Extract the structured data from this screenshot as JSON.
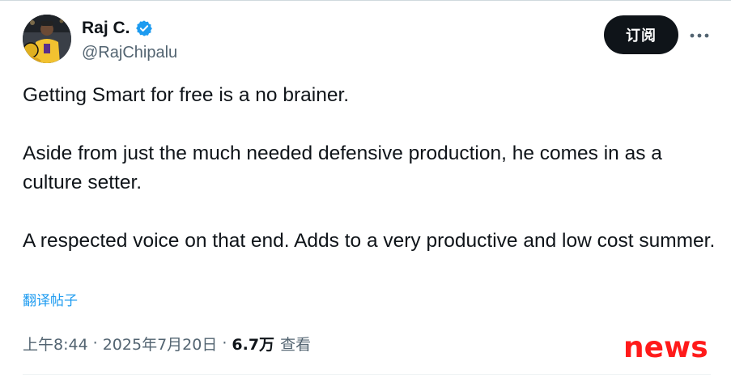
{
  "author": {
    "display_name": "Raj C.",
    "handle": "@RajChipalu",
    "verified": true,
    "avatar_icon": "profile-photo"
  },
  "header": {
    "subscribe_label": "订阅",
    "more_icon": "more-horizontal-icon"
  },
  "tweet": {
    "paragraphs": [
      "Getting Smart for free is a no brainer.",
      "Aside from just the much needed defensive production, he comes in as a culture setter.",
      "A respected voice on that end. Adds to a very productive and low cost summer."
    ],
    "translate_label": "翻译帖子"
  },
  "meta": {
    "time": "上午8:44",
    "separator": "·",
    "date": "2025年7月20日",
    "views_count": "6.7万",
    "views_label": "查看"
  },
  "watermark": {
    "text": "news"
  },
  "colors": {
    "text_primary": "#0f1419",
    "text_secondary": "#536471",
    "link": "#1d9bf0",
    "verified": "#1d9bf0",
    "button_bg": "#0f1419",
    "watermark": "#ff1a1a"
  }
}
